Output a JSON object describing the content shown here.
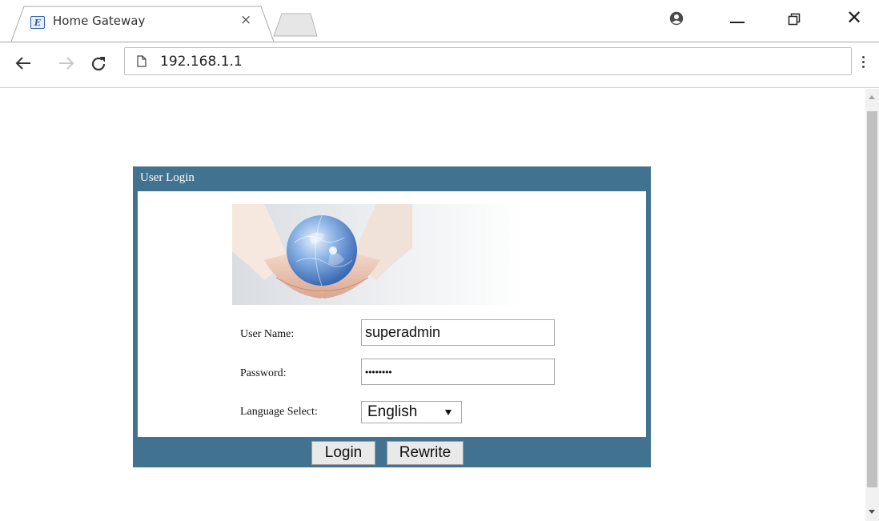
{
  "browser": {
    "tab": {
      "title": "Home Gateway",
      "favicon_letter": "E",
      "close_glyph": "×"
    },
    "window_controls": {
      "close_glyph": "✕"
    },
    "toolbar": {
      "url": "192.168.1.1"
    }
  },
  "login": {
    "header": "User Login",
    "fields": {
      "username_label": "User Name:",
      "username_value": "superadmin",
      "password_label": "Password:",
      "password_mask": "••••••••",
      "language_label": "Language Select:",
      "language_value": "English"
    },
    "buttons": {
      "login": "Login",
      "rewrite": "Rewrite"
    }
  },
  "colors": {
    "panel": "#41728f",
    "globe": "#4f86c6"
  }
}
